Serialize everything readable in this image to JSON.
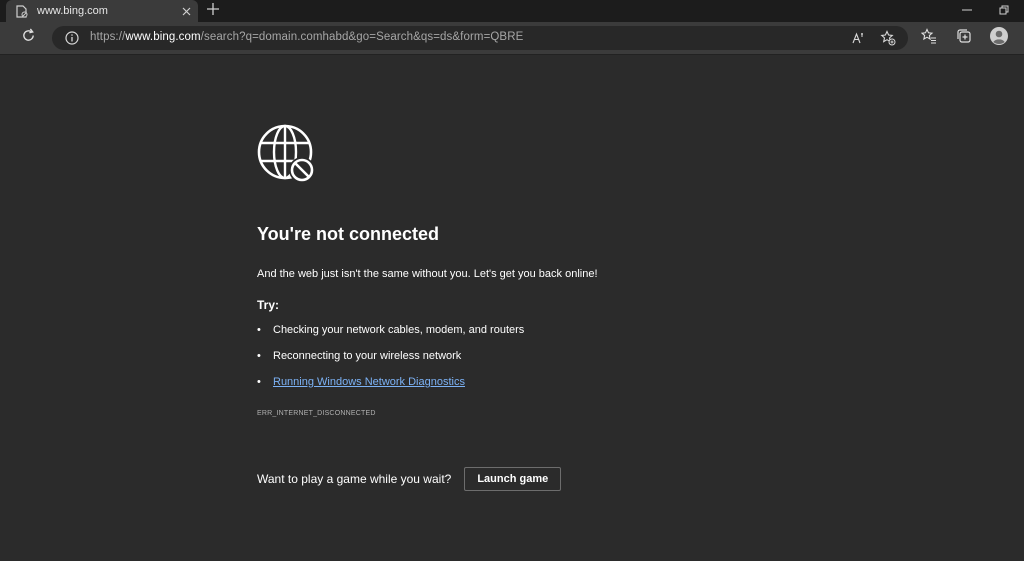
{
  "tab": {
    "title": "www.bing.com"
  },
  "address": {
    "scheme": "https://",
    "host": "www.bing.com",
    "path": "/search?q=domain.comhabd&go=Search&qs=ds&form=QBRE"
  },
  "page": {
    "heading": "You're not connected",
    "subtext": "And the web just isn't the same without you. Let's get you back online!",
    "try_label": "Try:",
    "tips": [
      "Checking your network cables, modem, and routers",
      "Reconnecting to your wireless network"
    ],
    "diagnostics_link": "Running Windows Network Diagnostics",
    "error_code": "ERR_INTERNET_DISCONNECTED",
    "game_prompt": "Want to play a game while you wait?",
    "launch_game_label": "Launch game"
  },
  "icons": {
    "favicon": "page-offline-icon",
    "tab_close": "close-icon",
    "new_tab": "plus-icon",
    "refresh": "refresh-icon",
    "info": "info-icon",
    "read_aloud": "read-aloud-icon",
    "add_favorite": "star-add-icon",
    "favorites": "favorites-icon",
    "collections": "collections-icon",
    "profile": "profile-icon",
    "minimize": "minimize-icon",
    "restore": "restore-icon",
    "globe_offline": "globe-offline-icon"
  },
  "colors": {
    "page_bg": "#2b2b2b",
    "toolbar_bg": "#3b3b3b",
    "link": "#7cb2f5"
  }
}
